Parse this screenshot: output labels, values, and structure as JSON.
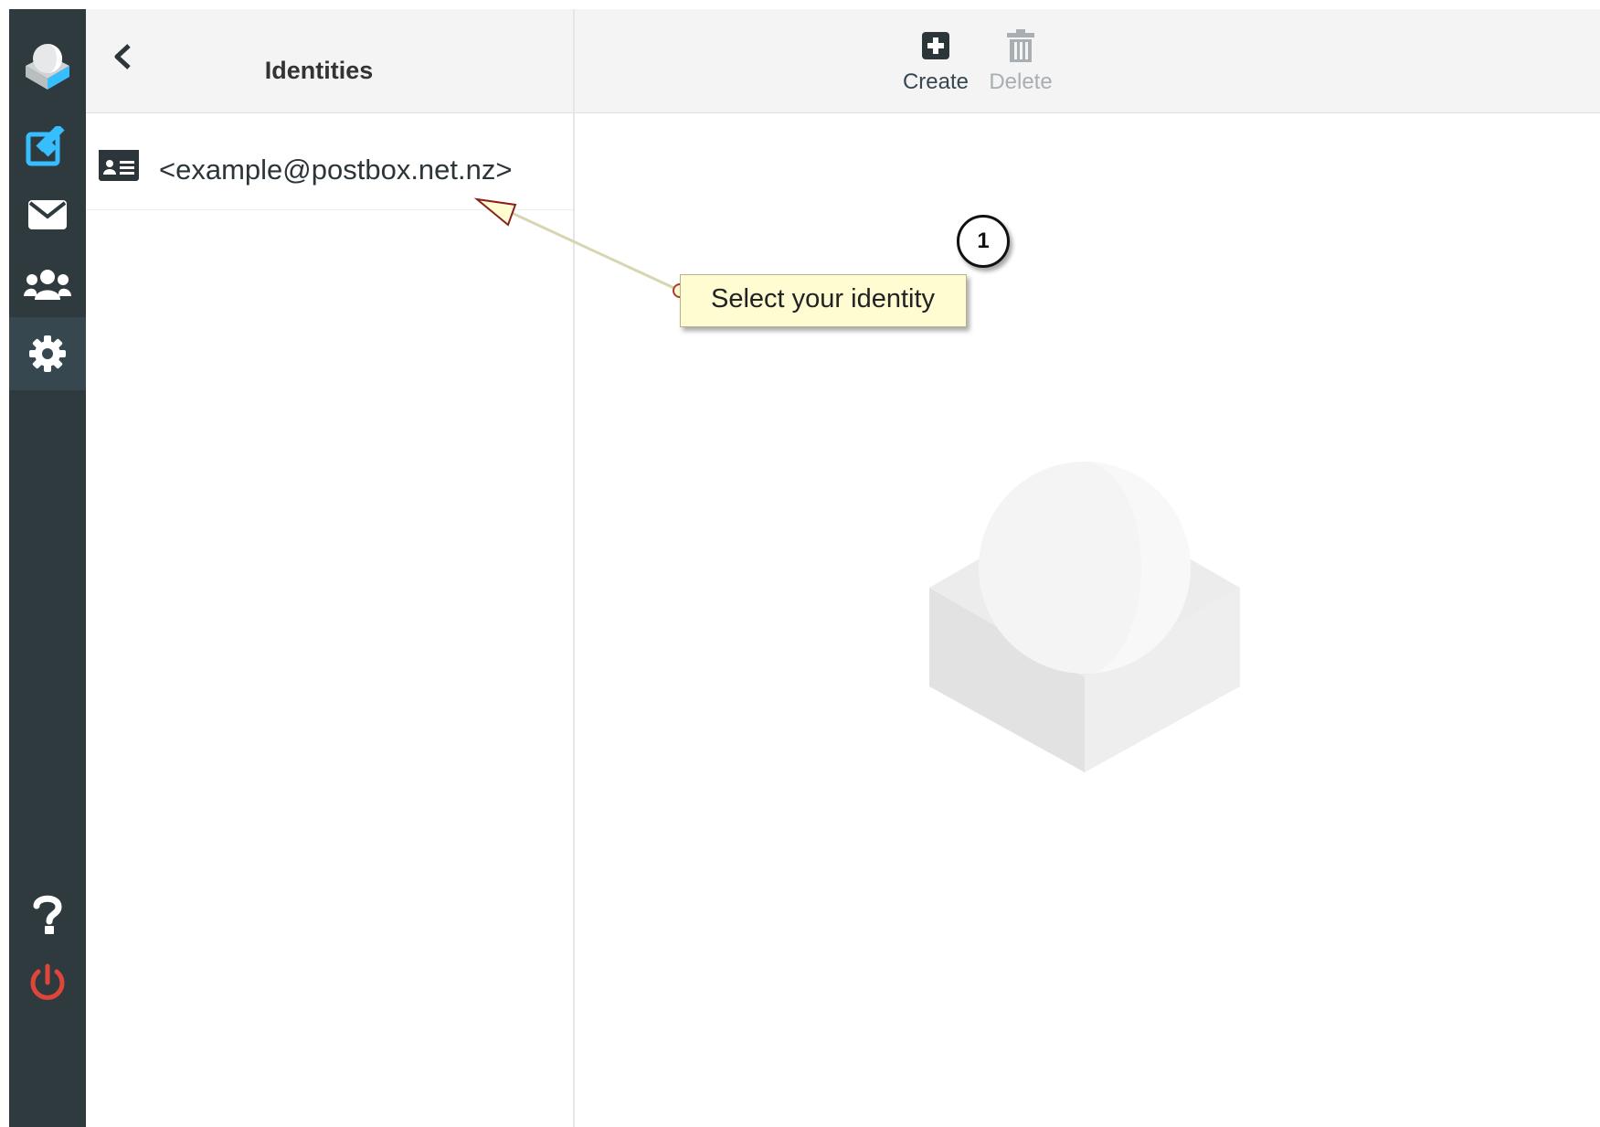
{
  "rail": {
    "items": [
      {
        "name": "logo",
        "icon": "roundcube-logo-icon"
      },
      {
        "name": "compose",
        "icon": "compose-icon",
        "color": "#37beff"
      },
      {
        "name": "mail",
        "icon": "envelope-icon"
      },
      {
        "name": "contacts",
        "icon": "users-icon"
      },
      {
        "name": "settings",
        "icon": "gear-icon",
        "active": true
      },
      {
        "name": "help",
        "icon": "help-icon"
      },
      {
        "name": "logout",
        "icon": "power-icon",
        "color": "#e0453a"
      }
    ]
  },
  "list": {
    "title": "Identities",
    "items": [
      {
        "label": "<example@postbox.net.nz>",
        "icon": "id-card-icon"
      }
    ]
  },
  "toolbar": {
    "create_label": "Create",
    "delete_label": "Delete"
  },
  "annotation": {
    "badge": "1",
    "text": "Select your identity"
  },
  "colors": {
    "rail_bg": "#2f3a3f",
    "accent_blue": "#37beff",
    "logout_red": "#e0453a",
    "callout_bg": "#fffcd2"
  }
}
